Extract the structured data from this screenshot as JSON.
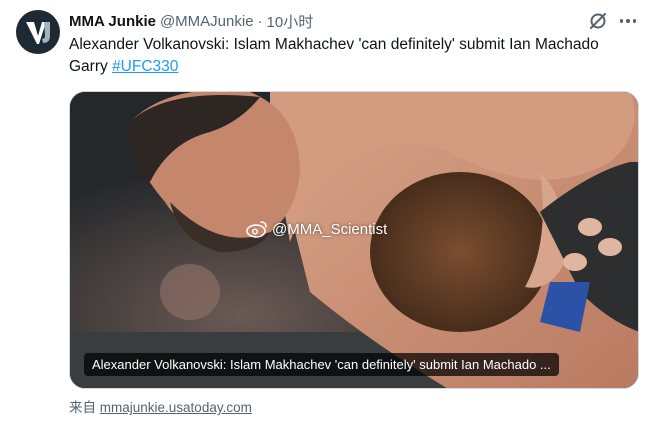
{
  "author": {
    "name": "MMA Junkie",
    "handle": "@MMAJunkie",
    "separator": "·",
    "time": "10小时"
  },
  "tweet": {
    "text": "Alexander Volkanovski: Islam Makhachev 'can definitely' submit Ian Machado Garry ",
    "hashtag": "#UFC330"
  },
  "media": {
    "watermark": "@MMA_Scientist",
    "caption": "Alexander Volkanovski: Islam Makhachev 'can definitely' submit Ian Machado ..."
  },
  "source": {
    "prefix": "来自 ",
    "domain": "mmajunkie.usatoday.com"
  },
  "icons": {
    "avatar": "mma-junkie-logo",
    "grok": "grok-icon",
    "more": "more-icon",
    "watermark": "weibo-icon"
  },
  "colors": {
    "link": "#1d9bf0",
    "secondary": "#536471"
  }
}
